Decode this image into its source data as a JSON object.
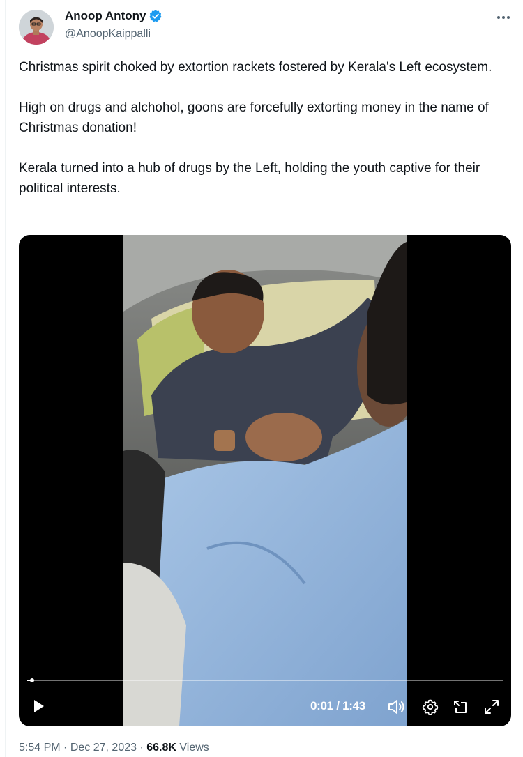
{
  "author": {
    "name": "Anoop Antony",
    "handle": "@AnoopKaippalli",
    "verified": true
  },
  "tweet": {
    "paragraphs": [
      "Christmas spirit choked by extortion rackets fostered by Kerala's Left ecosystem.",
      "High on drugs and alchohol, goons are forcefully extorting money in the name of Christmas donation!",
      "Kerala turned into a hub of drugs by the Left, holding the youth captive for their political interests."
    ]
  },
  "video": {
    "current_time": "0:01",
    "duration": "1:43",
    "time_display": "0:01 / 1:43",
    "progress_fraction": 0.01
  },
  "meta": {
    "time": "5:54 PM",
    "date": "Dec 27, 2023",
    "views_count": "66.8K",
    "views_label": "Views",
    "separator": "·"
  },
  "colors": {
    "text_primary": "#0f1419",
    "text_secondary": "#536471",
    "verified_blue": "#1d9bf0"
  },
  "icons": [
    "more-icon",
    "verified-badge-icon",
    "play-icon",
    "volume-icon",
    "settings-gear-icon",
    "picture-in-picture-icon",
    "fullscreen-icon"
  ]
}
